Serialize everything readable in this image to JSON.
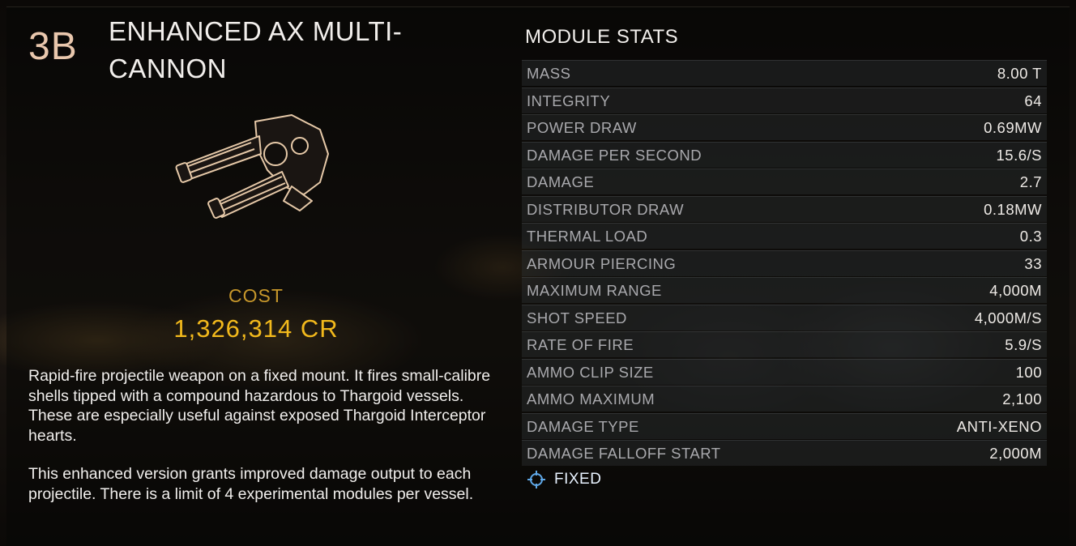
{
  "module": {
    "grade": "3B",
    "name": "ENHANCED AX MULTI-CANNON",
    "image_icon": "multi-cannon-icon",
    "cost_label": "COST",
    "cost_value": "1,326,314 CR",
    "description_1": "Rapid-fire projectile weapon on a fixed mount. It fires small-calibre shells tipped with a compound hazardous to Thargoid vessels. These are especially useful against exposed Thargoid Interceptor hearts.",
    "description_2": "This enhanced version grants improved damage output to each projectile. There is a limit of 4 experimental modules per vessel."
  },
  "stats": {
    "title": "MODULE STATS",
    "rows": [
      {
        "label": "MASS",
        "value": "8.00 T"
      },
      {
        "label": "INTEGRITY",
        "value": "64"
      },
      {
        "label": "POWER DRAW",
        "value": "0.69MW"
      },
      {
        "label": "DAMAGE PER SECOND",
        "value": "15.6/S"
      },
      {
        "label": "DAMAGE",
        "value": "2.7"
      },
      {
        "label": "DISTRIBUTOR DRAW",
        "value": "0.18MW"
      },
      {
        "label": "THERMAL LOAD",
        "value": "0.3"
      },
      {
        "label": "ARMOUR PIERCING",
        "value": "33"
      },
      {
        "label": "MAXIMUM RANGE",
        "value": "4,000M"
      },
      {
        "label": "SHOT SPEED",
        "value": "4,000M/S"
      },
      {
        "label": "RATE OF FIRE",
        "value": "5.9/S"
      },
      {
        "label": "AMMO CLIP SIZE",
        "value": "100"
      },
      {
        "label": "AMMO MAXIMUM",
        "value": "2,100"
      },
      {
        "label": "DAMAGE TYPE",
        "value": "ANTI-XENO"
      },
      {
        "label": "DAMAGE FALLOFF START",
        "value": "2,000M"
      }
    ]
  },
  "mount": {
    "icon": "crosshair-icon",
    "label": "FIXED"
  },
  "colors": {
    "cost_label": "#c7972b",
    "cost_value": "#f2b91c",
    "grade": "#e9c7ad",
    "mount_icon": "#5fa8e8"
  }
}
